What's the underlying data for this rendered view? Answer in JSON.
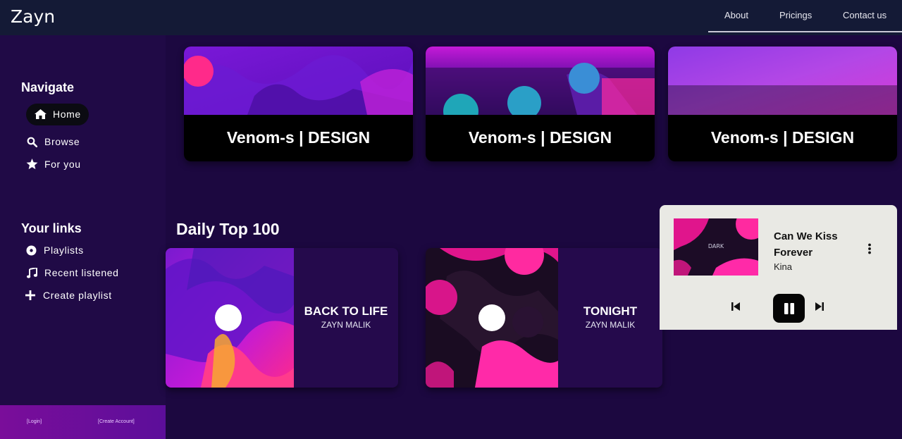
{
  "app": {
    "brand": "Zayn"
  },
  "topnav": {
    "items": [
      {
        "label": "About"
      },
      {
        "label": "Pricings"
      },
      {
        "label": "Contact us"
      }
    ]
  },
  "sidebar": {
    "navigate_title": "Navigate",
    "nav_items": [
      {
        "label": "Home",
        "icon": "home-icon",
        "active": true
      },
      {
        "label": "Browse",
        "icon": "search-icon"
      },
      {
        "label": "For you",
        "icon": "star-icon"
      }
    ],
    "links_title": "Your links",
    "link_items": [
      {
        "label": "Playlists",
        "icon": "disc-icon"
      },
      {
        "label": "Recent listened",
        "icon": "music-note-icon"
      },
      {
        "label": "Create playlist",
        "icon": "plus-icon"
      }
    ],
    "footer": {
      "login": "[Login]",
      "create_account": "[Create Account]"
    }
  },
  "banners": [
    {
      "title": "Venom-s | DESIGN"
    },
    {
      "title": "Venom-s | DESIGN"
    },
    {
      "title": "Venom-s | DESIGN"
    }
  ],
  "daily": {
    "title": "Daily Top 100",
    "tracks": [
      {
        "name": "BACK TO LIFE",
        "artist": "ZAYN MALIK"
      },
      {
        "name": "TONIGHT",
        "artist": "ZAYN MALIK"
      }
    ]
  },
  "player": {
    "song": "Can We Kiss Forever",
    "artist": "Kina",
    "thumb_text": "DARK"
  },
  "colors": {
    "background": "#1c0840",
    "topbar": "#141a36",
    "sidebar": "#200a46",
    "accent": "#d81b9c",
    "player_bg": "#e9e9e4"
  }
}
